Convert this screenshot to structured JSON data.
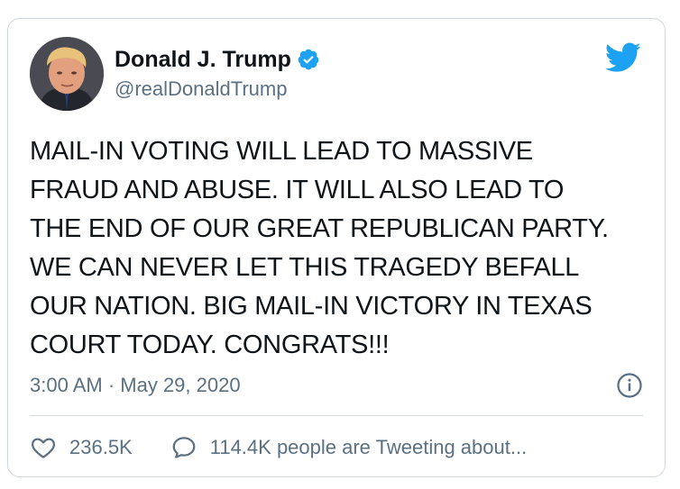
{
  "user": {
    "display_name": "Donald J. Trump",
    "handle": "@realDonaldTrump",
    "verified": true,
    "avatar_icon": "profile-photo"
  },
  "tweet": {
    "text": "MAIL-IN VOTING WILL LEAD TO MASSIVE\nFRAUD AND ABUSE. IT WILL ALSO LEAD TO\nTHE END OF OUR GREAT REPUBLICAN PARTY.\nWE CAN NEVER LET THIS TRAGEDY BEFALL\nOUR NATION. BIG MAIL-IN VICTORY IN TEXAS\nCOURT TODAY. CONGRATS!!!",
    "timestamp": "3:00 AM · May 29, 2020"
  },
  "actions": {
    "likes": "236.5K",
    "conversation": "114.4K people are Tweeting about..."
  },
  "colors": {
    "brand": "#1da1f2",
    "text": "#0f1419",
    "secondary": "#5b7083",
    "border": "#d0d7de"
  },
  "icons": [
    "verified-badge-icon",
    "twitter-bird-icon",
    "info-icon",
    "heart-icon",
    "comment-icon"
  ]
}
